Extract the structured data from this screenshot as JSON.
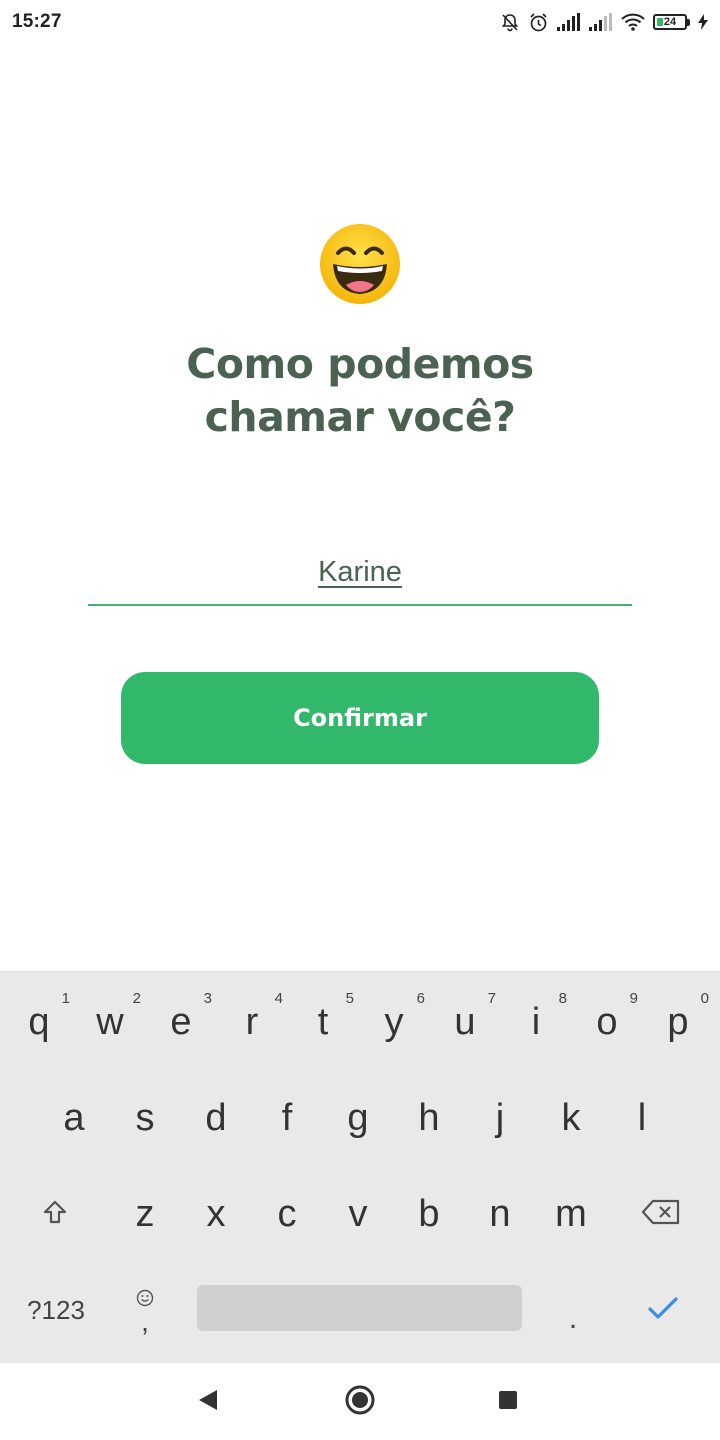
{
  "status_bar": {
    "time": "15:27",
    "battery_level": "24",
    "icons": [
      "bell-off-icon",
      "alarm-icon",
      "signal-icon",
      "signal-icon",
      "wifi-icon",
      "battery-icon",
      "charging-icon"
    ]
  },
  "main": {
    "emoji": "grinning-face-with-smiling-eyes",
    "title_line1": "Como podemos",
    "title_line2": "chamar você?",
    "name_value": "Karine",
    "confirm_label": "Confirmar"
  },
  "keyboard": {
    "row1": [
      {
        "key": "q",
        "num": "1"
      },
      {
        "key": "w",
        "num": "2"
      },
      {
        "key": "e",
        "num": "3"
      },
      {
        "key": "r",
        "num": "4"
      },
      {
        "key": "t",
        "num": "5"
      },
      {
        "key": "y",
        "num": "6"
      },
      {
        "key": "u",
        "num": "7"
      },
      {
        "key": "i",
        "num": "8"
      },
      {
        "key": "o",
        "num": "9"
      },
      {
        "key": "p",
        "num": "0"
      }
    ],
    "row2": [
      "a",
      "s",
      "d",
      "f",
      "g",
      "h",
      "j",
      "k",
      "l"
    ],
    "row3": [
      "z",
      "x",
      "c",
      "v",
      "b",
      "n",
      "m"
    ],
    "symbols_label": "?123",
    "comma_label": ",",
    "period_label": "."
  },
  "colors": {
    "accent": "#32b86a",
    "title": "#4b6152",
    "field_line": "#4caf72"
  }
}
